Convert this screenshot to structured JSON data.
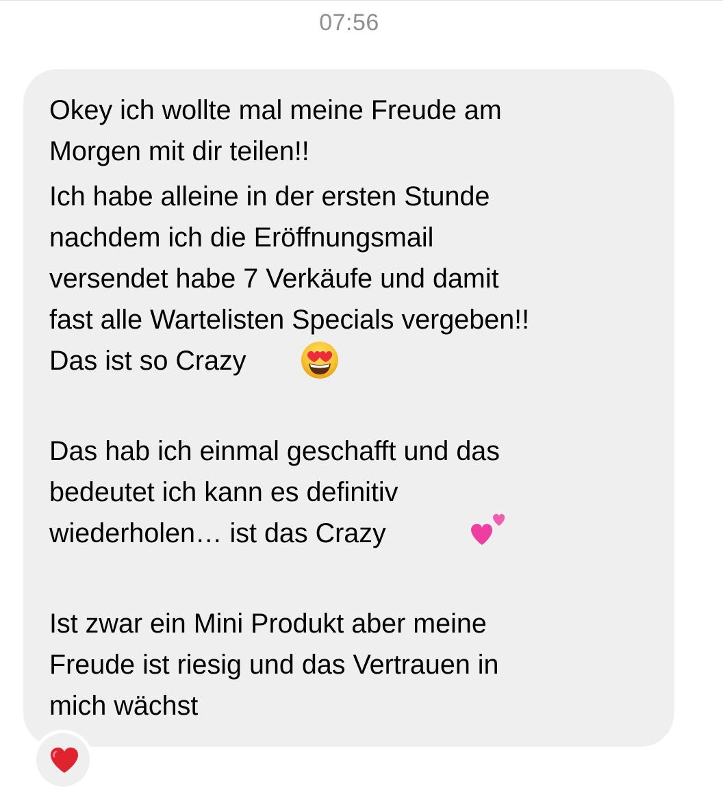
{
  "thread": {
    "timestamp": "07:56"
  },
  "message": {
    "lines": [
      "Okey ich wollte mal meine Freude am",
      "Morgen mit dir teilen!!",
      "Ich habe alleine in der ersten Stunde",
      "nachdem ich die Eröffnungsmail",
      "versendet habe 7 Verkäufe und damit",
      "fast alle Wartelisten Specials vergeben!!",
      "Das ist so Crazy",
      "Das hab ich einmal geschafft und das",
      "bedeutet ich kann es definitiv",
      "wiederholen… ist das Crazy",
      "Ist zwar ein Mini Produkt aber meine",
      "Freude ist riesig und das Vertrauen in",
      "mich wächst"
    ],
    "emojis": {
      "first": "heart-eyes-emoji",
      "second": "two-hearts-emoji"
    },
    "bubble_color": "#efefef"
  },
  "reaction": {
    "icon": "red-heart-icon",
    "color": "#e0242f"
  }
}
